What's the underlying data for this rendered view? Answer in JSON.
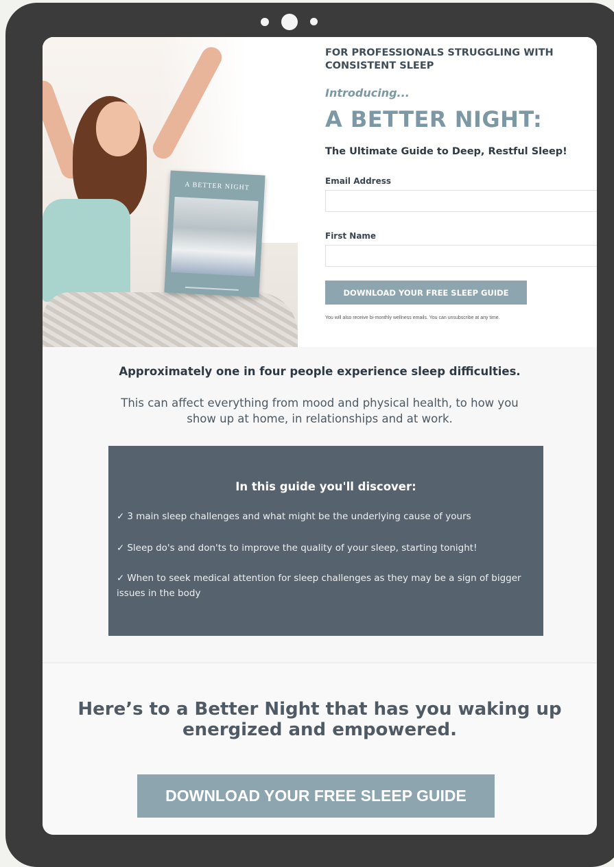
{
  "hero": {
    "kicker": "FOR PROFESSIONALS STRUGGLING WITH CONSISTENT SLEEP",
    "intro": "Introducing...",
    "title": "A BETTER NIGHT:",
    "subtitle": "The Ultimate Guide to Deep, Restful Sleep!",
    "book_cover_title": "A BETTER NIGHT"
  },
  "form": {
    "email_label": "Email Address",
    "email_value": "",
    "first_name_label": "First Name",
    "first_name_value": "",
    "submit_label": "DOWNLOAD YOUR FREE SLEEP GUIDE",
    "disclaimer": "You will also receive bi-monthly wellness emails. You can unsubscribe at any time."
  },
  "info": {
    "stat": "Approximately one in four people experience sleep difficulties.",
    "paragraph": "This can affect everything from mood and physical health, to how you show up at home, in relationships and at work."
  },
  "panel": {
    "title": "In this guide you'll discover:",
    "check_glyph": "✓",
    "items": [
      "3 main sleep challenges and what might be the underlying cause of yours",
      "Sleep do's and don'ts to improve the quality of your sleep, starting tonight!",
      "When to seek medical attention for sleep challenges as they may be a sign of bigger issues in the body"
    ]
  },
  "closing": {
    "headline": "Here’s to a Better Night that has you waking up energized and empowered.",
    "cta_label": "DOWNLOAD YOUR FREE SLEEP GUIDE"
  },
  "colors": {
    "accent": "#7b98a4",
    "button": "#8ca5ae",
    "panel": "#56626d",
    "frame": "#3b3b3b"
  }
}
